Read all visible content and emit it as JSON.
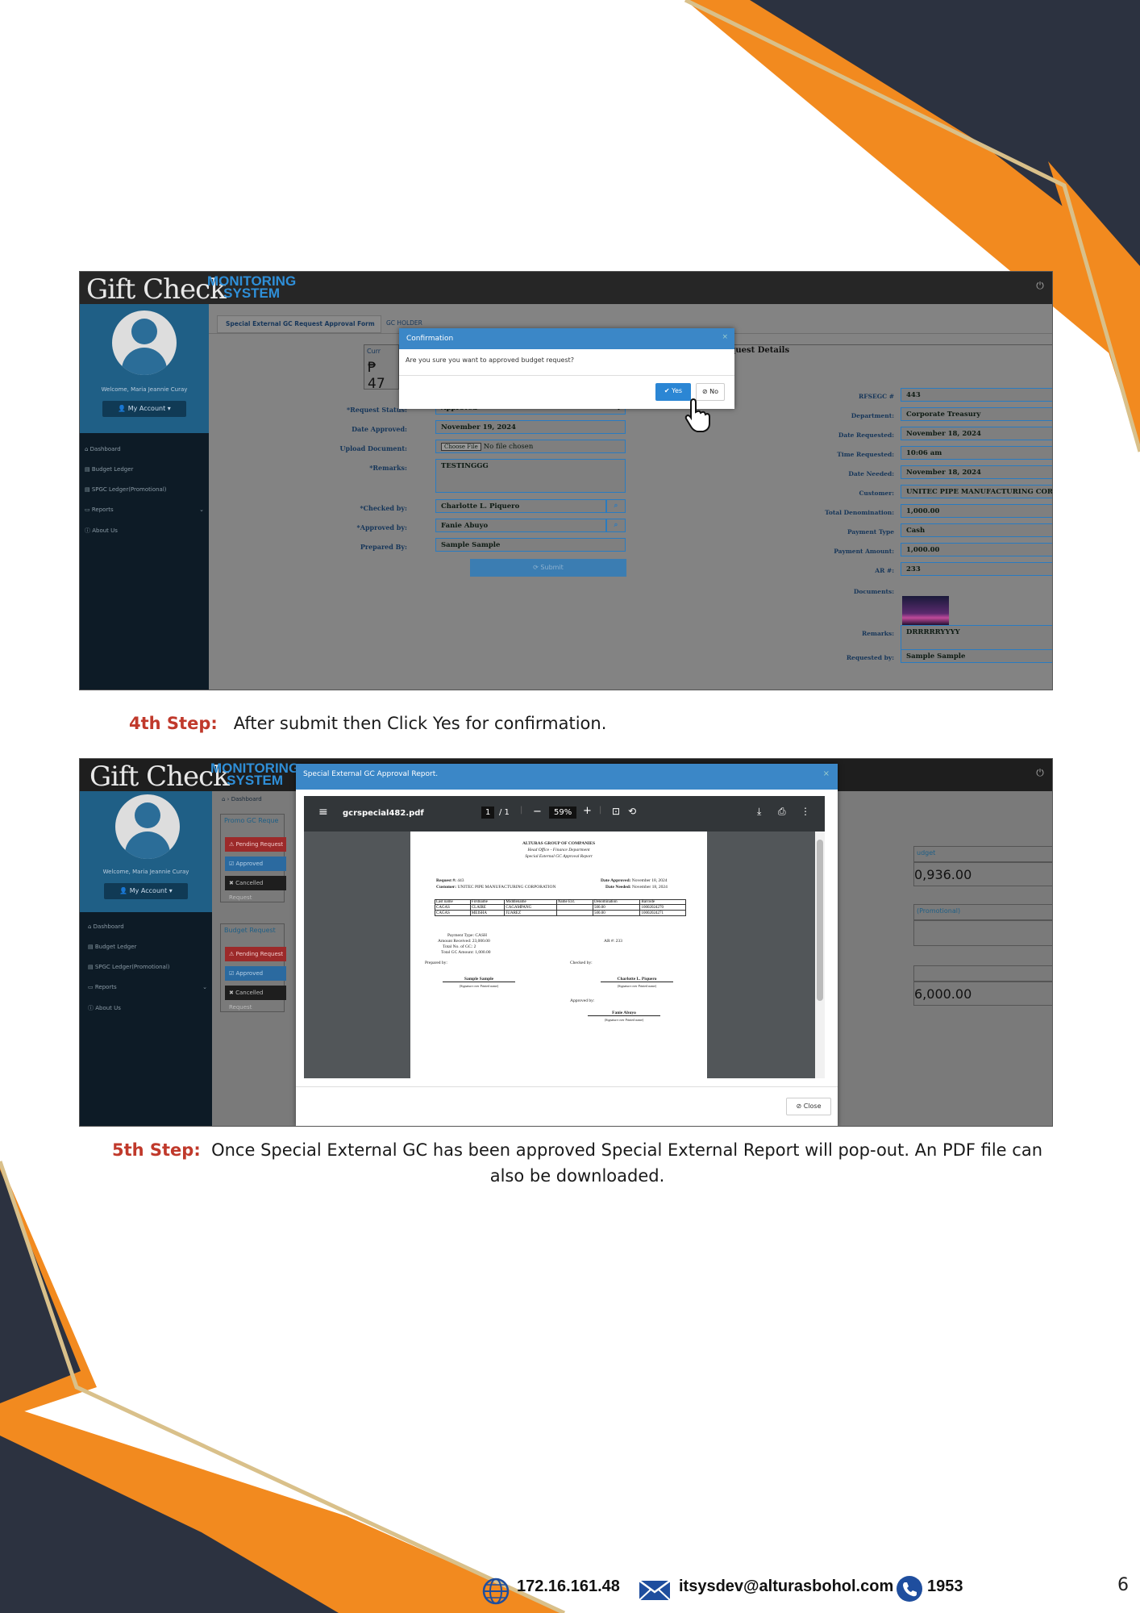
{
  "page_number": "6",
  "step4": {
    "label": "4th Step:",
    "text": "After submit then Click Yes for confirmation."
  },
  "step5": {
    "label": "5th Step:",
    "text": "Once Special External GC has been approved Special External Report will pop-out. An PDF file can also be downloaded."
  },
  "footer": {
    "ip": "172.16.161.48",
    "email": "itsysdev@alturasbohol.com",
    "phone": "1953"
  },
  "colors": {
    "orange": "#f28a1f",
    "navy": "#2c3240",
    "gold": "#d9c08a",
    "step_label": "#c0392b",
    "accent_blue": "#3b87c7"
  },
  "app": {
    "logo": "Gift Check",
    "logo_sub_1": "MONITORING",
    "logo_sub_2": "SYSTEM",
    "welcome": "Welcome, Maria Jeannie Curay",
    "my_account": "My Account",
    "nav": [
      "Dashboard",
      "Budget Ledger",
      "SPGC Ledger(Promotional)",
      "Reports",
      "About Us"
    ]
  },
  "screen1": {
    "tabs": [
      "Special External GC Request Approval Form",
      "GC HOLDER"
    ],
    "partial_cur": "Curr",
    "partial_amount": "₱ 47",
    "left_form": [
      {
        "label": "*Request Status:",
        "value": "Approved"
      },
      {
        "label": "Date Approved:",
        "value": "November 19, 2024"
      },
      {
        "label": "Upload Document:",
        "value": "No file chosen",
        "button": "Choose File"
      },
      {
        "label": "*Remarks:",
        "value": "TESTINGGG"
      },
      {
        "label": "*Checked by:",
        "value": "Charlotte L. Piquero"
      },
      {
        "label": "*Approved by:",
        "value": "Fanie Abuyo"
      },
      {
        "label": "Prepared By:",
        "value": "Sample Sample"
      }
    ],
    "submit": "Submit",
    "right_heading": "equest Details",
    "right_form": [
      {
        "label": "RFSEGC #",
        "value": "443"
      },
      {
        "label": "Department:",
        "value": "Corporate Treasury"
      },
      {
        "label": "Date Requested:",
        "value": "November 18, 2024"
      },
      {
        "label": "Time Requested:",
        "value": "10:06 am"
      },
      {
        "label": "Date Needed:",
        "value": "November 18, 2024"
      },
      {
        "label": "Customer:",
        "value": "UNITEC PIPE MANUFACTURING CORPORATIO"
      },
      {
        "label": "Total Denomination:",
        "value": "1,000.00"
      },
      {
        "label": "Payment Type",
        "value": "Cash"
      },
      {
        "label": "Payment Amount:",
        "value": "1,000.00"
      },
      {
        "label": "AR #:",
        "value": "233"
      },
      {
        "label": "Documents:",
        "value": ""
      },
      {
        "label": "Remarks:",
        "value": "DRRRRRYYYY"
      },
      {
        "label": "Requested by:",
        "value": "Sample Sample"
      }
    ],
    "modal": {
      "title": "Confirmation",
      "message": "Are you sure you want to approved budget request?",
      "yes": "Yes",
      "no": "No"
    }
  },
  "screen2": {
    "breadcrumb": "Dashboard",
    "promo_panel": "Promo GC Reque",
    "budget_panel": "Budget Request",
    "buttons": [
      "Pending Request",
      "Approved Request",
      "Cancelled Request"
    ],
    "right_budget": "udget",
    "right_amount1": "0,936.00",
    "right_promo": "(Promotional)",
    "right_amount2": "6,000.00",
    "modal": {
      "title": "Special External GC Approval Report.",
      "filename": "gcrspecial482.pdf",
      "page": "1",
      "pages": "/ 1",
      "zoom": "59%",
      "close": "Close"
    },
    "report": {
      "company": "ALTURAS GROUP OF COMPANIES",
      "office": "Head Office - Finance Department",
      "title": "Special External GC Approval Report",
      "request_no_label": "Request #:",
      "request_no": "443",
      "customer_label": "Customer:",
      "customer": "UNITEC PIPE MANUFACTURING CORPORATION",
      "date_approved_label": "Date Approved:",
      "date_approved": "November 18, 2024",
      "date_needed_label": "Date Needed:",
      "date_needed": "November 18, 2024",
      "table_headers": [
        "Last name",
        "Firstname",
        "Middlename",
        "Name Ext.",
        "Denomination",
        "Barcode"
      ],
      "table_rows": [
        [
          "CAGAS",
          "CLAIRE",
          "CAGAMPANG",
          "",
          "500.00",
          "10002024270"
        ],
        [
          "CAGAS",
          "MEISHA",
          "JUAREZ",
          "",
          "500.00",
          "10002024271"
        ]
      ],
      "payment_type": "Payment Type:  CASH",
      "amount_received": "Amount Received:  23,000.00",
      "total_no": "Total No. of GC:  2",
      "total_amount": "Total GC Amount:  1,000.00",
      "ar": "AR #:  233",
      "prepared_by": "Prepared by:",
      "checked_by": "Checked by:",
      "approved_by": "Approved by:",
      "prepared_name": "Sample Sample",
      "checked_name": "Charlotte L. Piquero",
      "approved_name": "Fanie Abuyo",
      "sig_caption": "(Signature over Printed name)"
    }
  }
}
